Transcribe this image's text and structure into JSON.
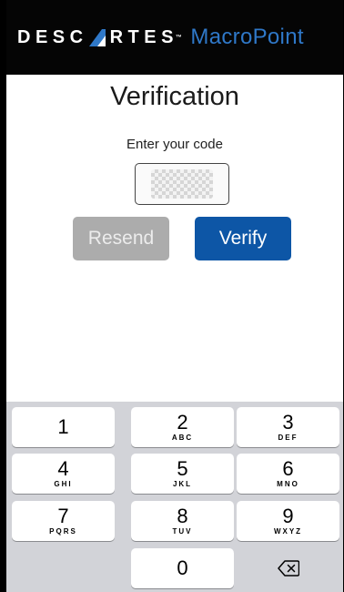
{
  "header": {
    "brand_part1": "DESC",
    "brand_part2": "RTES",
    "brand_tm": "™",
    "product": "MacroPoint",
    "colors": {
      "background": "#050505",
      "product": "#2f78c8",
      "logo_mark": "#2f78c8"
    }
  },
  "page": {
    "title": "Verification",
    "prompt": "Enter your code",
    "code_field": {
      "value": "",
      "masked": true
    }
  },
  "buttons": {
    "resend": {
      "label": "Resend",
      "enabled": false,
      "color": "#acacac"
    },
    "verify": {
      "label": "Verify",
      "enabled": true,
      "color": "#0d56a6"
    }
  },
  "keypad": {
    "keys": [
      {
        "num": "1",
        "letters": ""
      },
      {
        "num": "2",
        "letters": "ABC"
      },
      {
        "num": "3",
        "letters": "DEF"
      },
      {
        "num": "4",
        "letters": "GHI"
      },
      {
        "num": "5",
        "letters": "JKL"
      },
      {
        "num": "6",
        "letters": "MNO"
      },
      {
        "num": "7",
        "letters": "PQRS"
      },
      {
        "num": "8",
        "letters": "TUV"
      },
      {
        "num": "9",
        "letters": "WXYZ"
      },
      {
        "num": "0",
        "letters": ""
      }
    ],
    "delete_icon": "backspace-icon"
  }
}
